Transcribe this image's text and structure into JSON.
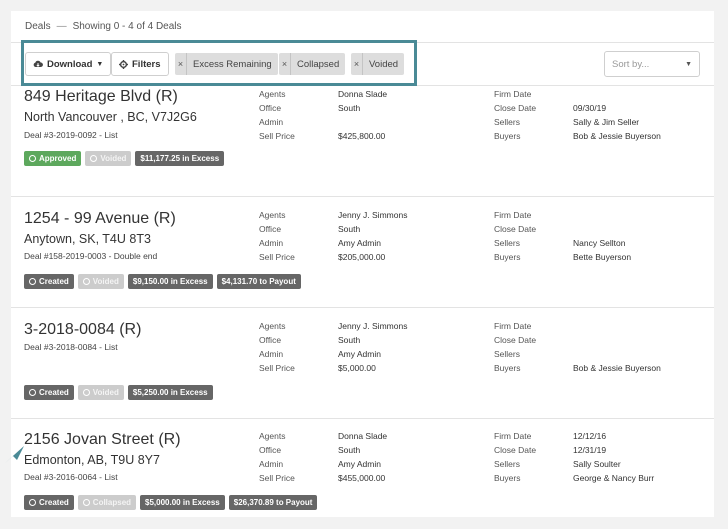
{
  "header": {
    "title": "Deals",
    "separator": "—",
    "showing": "Showing 0 - 4 of 4 Deals"
  },
  "toolbar": {
    "download_label": "Download",
    "filters_label": "Filters",
    "chips": [
      "Excess Remaining",
      "Collapsed",
      "Voided"
    ],
    "chip_remove": "×",
    "sort_placeholder": "Sort by..."
  },
  "field_labels": {
    "agents": "Agents",
    "office": "Office",
    "admin": "Admin",
    "sell_price": "Sell Price",
    "firm_date": "Firm Date",
    "close_date": "Close Date",
    "sellers": "Sellers",
    "buyers": "Buyers"
  },
  "deals": [
    {
      "title": "849 Heritage Blvd (R)",
      "address": "North Vancouver , BC, V7J2G6",
      "sub": "Deal #3-2019-0092 - List",
      "agents": "Donna Slade",
      "office": "South",
      "admin": "",
      "sell_price": "$425,800.00",
      "firm_date": "",
      "close_date": "09/30/19",
      "sellers": "Sally & Jim Seller",
      "buyers": "Bob & Jessie Buyerson",
      "badges": [
        "Approved",
        "Voided",
        "$11,177.25 in Excess"
      ]
    },
    {
      "title": "1254 - 99 Avenue (R)",
      "address": "Anytown, SK, T4U 8T3",
      "sub": "Deal #158-2019-0003 - Double end",
      "agents": "Jenny J. Simmons",
      "office": "South",
      "admin": "Amy Admin",
      "sell_price": "$205,000.00",
      "firm_date": "",
      "close_date": "",
      "sellers": "Nancy Sellton",
      "buyers": "Bette Buyerson",
      "badges": [
        "Created",
        "Voided",
        "$9,150.00 in Excess",
        "$4,131.70 to Payout"
      ]
    },
    {
      "title": "3-2018-0084 (R)",
      "address": "",
      "sub": "Deal #3-2018-0084 - List",
      "agents": "Jenny J. Simmons",
      "office": "South",
      "admin": "Amy Admin",
      "sell_price": "$5,000.00",
      "firm_date": "",
      "close_date": "",
      "sellers": "",
      "buyers": "Bob & Jessie Buyerson",
      "badges": [
        "Created",
        "Voided",
        "$5,250.00 in Excess"
      ]
    },
    {
      "title": "2156 Jovan Street (R)",
      "address": "Edmonton, AB, T9U 8Y7",
      "sub": "Deal #3-2016-0064 - List",
      "agents": "Donna Slade",
      "office": "South",
      "admin": "Amy Admin",
      "sell_price": "$455,000.00",
      "firm_date": "12/12/16",
      "close_date": "12/31/19",
      "sellers": "Sally Soulter",
      "buyers": "George & Nancy Burr",
      "badges": [
        "Created",
        "Collapsed",
        "$5,000.00 in Excess",
        "$26,370.89 to Payout"
      ]
    }
  ],
  "colors": {
    "highlight": "#4a8a96",
    "approved": "#5da85d",
    "dark_badge": "#666666",
    "disabled_badge": "#cccccc"
  },
  "icons": {
    "download": "cloud-download-icon",
    "filters": "gear-icon",
    "annotation": "arrow-pointer-icon"
  }
}
